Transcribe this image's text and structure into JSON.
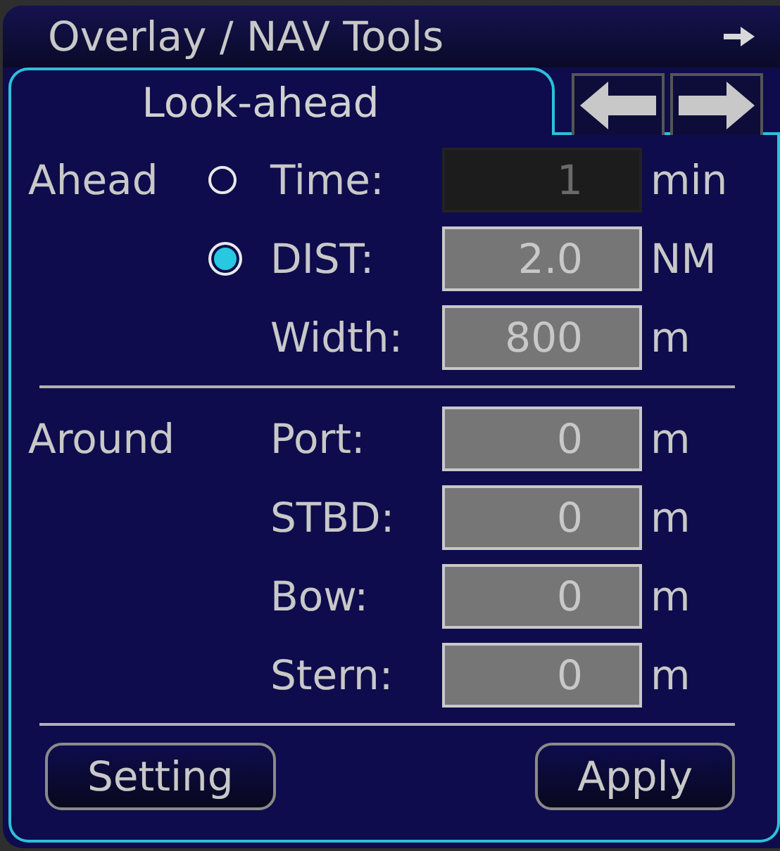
{
  "window": {
    "title": "Overlay / NAV Tools"
  },
  "tab": {
    "label": "Look-ahead",
    "selected": true
  },
  "ahead": {
    "label": "Ahead",
    "rows": [
      {
        "kind": "radio",
        "selected": false,
        "label": "Time:",
        "value": "1",
        "unit": "min",
        "disabled": true
      },
      {
        "kind": "radio",
        "selected": true,
        "label": "DIST:",
        "value": "2.0",
        "unit": "NM",
        "disabled": false
      },
      {
        "kind": "plain",
        "label": "Width:",
        "value": "800",
        "unit": "m",
        "disabled": false
      }
    ]
  },
  "around": {
    "label": "Around",
    "rows": [
      {
        "label": "Port:",
        "value": "0",
        "unit": "m",
        "disabled": false
      },
      {
        "label": "STBD:",
        "value": "0",
        "unit": "m",
        "disabled": false
      },
      {
        "label": "Bow:",
        "value": "0",
        "unit": "m",
        "disabled": false
      },
      {
        "label": "Stern:",
        "value": "0",
        "unit": "m",
        "disabled": false
      }
    ]
  },
  "buttons": [
    "Setting",
    "Apply"
  ]
}
